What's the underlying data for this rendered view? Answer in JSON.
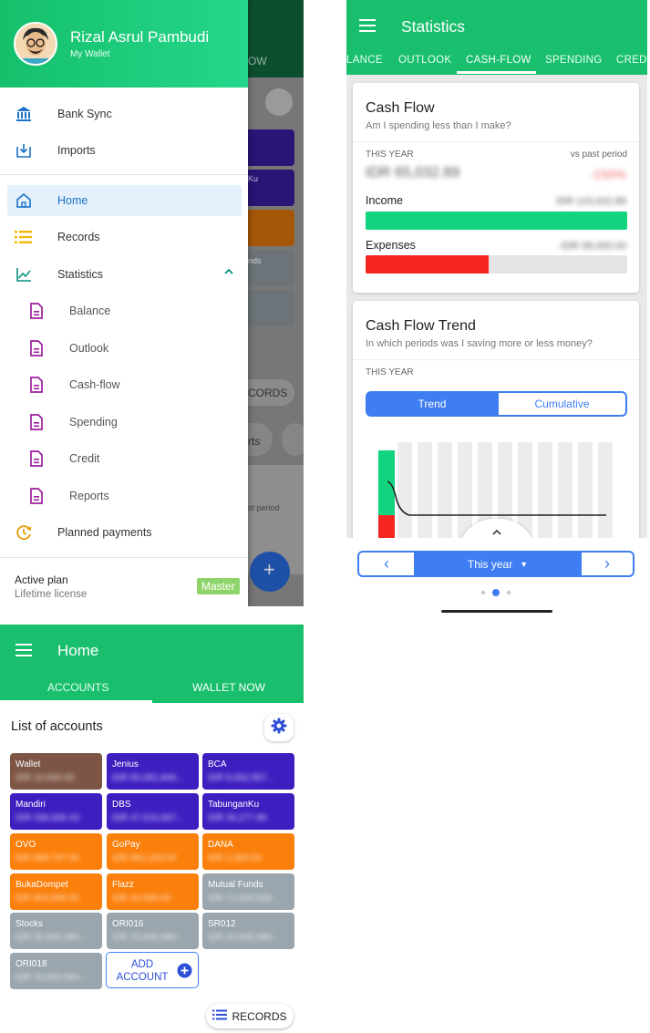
{
  "colors": {
    "green": "#19bf6d",
    "blue": "#3f7df3",
    "brown": "#7d5544",
    "purple": "#3f1ec0",
    "orange": "#fb7f0b",
    "grey": "#9aa5ad",
    "income": "#12d47f",
    "expense": "#f5261f"
  },
  "drawer": {
    "user_name": "Rizal Asrul Pambudi",
    "user_sub": "My Wallet",
    "items": [
      {
        "label": "Bank Sync",
        "icon": "bank-icon"
      },
      {
        "label": "Imports",
        "icon": "import-icon"
      },
      {
        "label": "Home",
        "icon": "home-icon"
      },
      {
        "label": "Records",
        "icon": "list-icon"
      },
      {
        "label": "Statistics",
        "icon": "chart-icon"
      },
      {
        "label": "Balance",
        "icon": "document-icon"
      },
      {
        "label": "Outlook",
        "icon": "document-icon"
      },
      {
        "label": "Cash-flow",
        "icon": "document-icon"
      },
      {
        "label": "Spending",
        "icon": "document-icon"
      },
      {
        "label": "Credit",
        "icon": "document-icon"
      },
      {
        "label": "Reports",
        "icon": "document-icon"
      },
      {
        "label": "Planned payments",
        "icon": "clock-icon"
      }
    ],
    "plan_label": "Active plan",
    "plan_value": "Lifetime license",
    "plan_badge": "Master",
    "behind": {
      "tab_fragment": "OW",
      "records_fragment": "CORDS",
      "reports_fragment": "rts",
      "period_fragment": "st period",
      "ku_fragment": "Ku",
      "nds_fragment": "nds"
    }
  },
  "stats": {
    "title": "Statistics",
    "tabs": [
      "LANCE",
      "OUTLOOK",
      "CASH-FLOW",
      "SPENDING",
      "CREDI"
    ],
    "active_tab": "CASH-FLOW",
    "cashflow": {
      "title": "Cash Flow",
      "subtitle": "Am I spending less than I make?",
      "period": "THIS YEAR",
      "compare": "vs past period",
      "total": "IDR 65,032.89",
      "change": "-150%",
      "income_label": "Income",
      "income_value": "IDR 123,022.89",
      "income_fraction": 1.0,
      "expense_label": "Expenses",
      "expense_value": "-IDR 58,000.00",
      "expense_fraction": 0.47
    },
    "trend": {
      "title": "Cash Flow Trend",
      "subtitle": "In which periods was I saving more or less money?",
      "period": "THIS YEAR",
      "toggle_on": "Trend",
      "toggle_off": "Cumulative"
    },
    "pager": {
      "prev": "‹",
      "label": "This year",
      "caret": "▼",
      "next": "›"
    }
  },
  "home": {
    "title": "Home",
    "tabs": [
      "ACCOUNTS",
      "WALLET NOW"
    ],
    "list_title": "List of accounts",
    "accounts": [
      {
        "name": "Wallet",
        "balance": "IDR 10,000.00",
        "color": "brown"
      },
      {
        "name": "Jenius",
        "balance": "IDR 60,081,849...",
        "color": "purple"
      },
      {
        "name": "BCA",
        "balance": "IDR 6,932,957...",
        "color": "purple"
      },
      {
        "name": "Mandiri",
        "balance": "IDR 336,500.43",
        "color": "purple"
      },
      {
        "name": "DBS",
        "balance": "IDR 47,515,697...",
        "color": "purple"
      },
      {
        "name": "TabunganKu",
        "balance": "IDR 26,277.89",
        "color": "purple"
      },
      {
        "name": "OVO",
        "balance": "IDR 899,797.00",
        "color": "orange"
      },
      {
        "name": "GoPay",
        "balance": "IDR 962,229.00",
        "color": "orange"
      },
      {
        "name": "DANA",
        "balance": "IDR 2,300.00",
        "color": "orange"
      },
      {
        "name": "BukaDompet",
        "balance": "IDR 804,899.00",
        "color": "orange"
      },
      {
        "name": "Flazz",
        "balance": "IDR 44,999.00",
        "color": "orange"
      },
      {
        "name": "Mutual Funds",
        "balance": "IDR 72,644,509...",
        "color": "grey"
      },
      {
        "name": "Stocks",
        "balance": "IDR 55,900,060...",
        "color": "grey"
      },
      {
        "name": "ORI016",
        "balance": "IDR 15,000,000...",
        "color": "grey"
      },
      {
        "name": "SR012",
        "balance": "IDR 20,000,000...",
        "color": "grey"
      },
      {
        "name": "ORI018",
        "balance": "IDR 15,002,004...",
        "color": "grey"
      }
    ],
    "add_account": "ADD\nACCOUNT",
    "records_button": "RECORDS"
  }
}
